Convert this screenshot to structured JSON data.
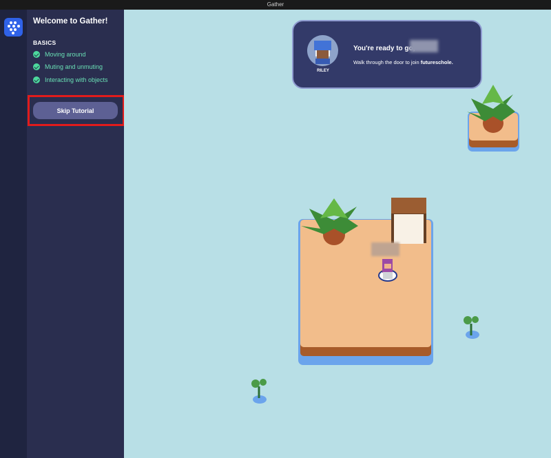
{
  "window": {
    "title": "Gather"
  },
  "sidebar": {
    "title": "Welcome to Gather!",
    "section_title": "BASICS",
    "tasks": [
      {
        "label": "Moving around",
        "complete": true
      },
      {
        "label": "Muting and unmuting",
        "complete": true
      },
      {
        "label": "Interacting with objects",
        "complete": true
      }
    ],
    "skip_label": "Skip Tutorial"
  },
  "notification": {
    "avatar_name": "RILEY",
    "title": "You're ready to go,",
    "message_prefix": "Walk through the door to join ",
    "space_name": "futureschole.",
    "name_blurred": true
  },
  "player": {
    "name_blurred": true
  },
  "map_objects": [
    {
      "name": "palm-tree"
    },
    {
      "name": "doorway"
    },
    {
      "name": "small-sprout"
    }
  ],
  "colors": {
    "background": "#1f2440",
    "sidebar": "#2a2e4f",
    "map_water": "#b8dfe6",
    "accent": "#2f62e8",
    "completed": "#4cd99d",
    "highlight": "#e21b1b"
  }
}
